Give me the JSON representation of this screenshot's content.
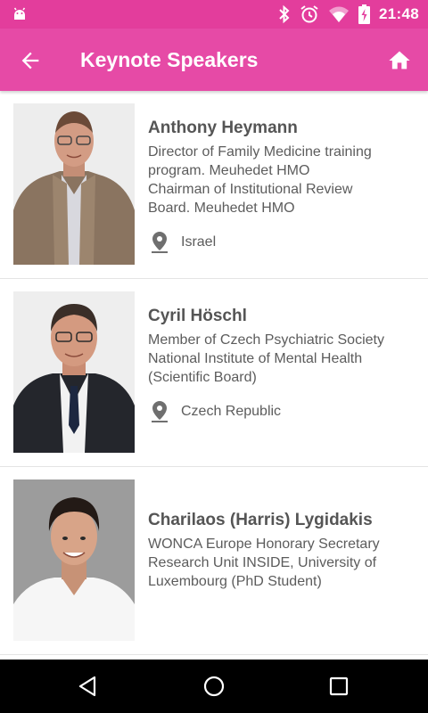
{
  "status_bar": {
    "time": "21:48",
    "icons": [
      "android-debug-icon",
      "bluetooth-icon",
      "alarm-icon",
      "wifi-icon",
      "battery-charging-icon"
    ]
  },
  "app_bar": {
    "title": "Keynote Speakers",
    "back_icon": "arrow-back-icon",
    "home_icon": "home-icon"
  },
  "speakers": [
    {
      "name": "Anthony Heymann",
      "description": [
        "Director of Family Medicine training",
        "program. Meuhedet HMO",
        "Chairman of Institutional Review",
        "Board. Meuhedet HMO"
      ],
      "location": "Israel"
    },
    {
      "name": "Cyril Höschl",
      "description": [
        "Member of Czech Psychiatric Society",
        "National Institute of Mental Health",
        "(Scientific Board)"
      ],
      "location": "Czech Republic"
    },
    {
      "name": "Charilaos (Harris) Lygidakis",
      "description": [
        "WONCA Europe Honorary Secretary",
        "Research Unit INSIDE, University of",
        "Luxembourg (PhD Student)"
      ],
      "location": ""
    }
  ],
  "nav_bar": {
    "icons": [
      "nav-back-icon",
      "nav-home-icon",
      "nav-recents-icon"
    ]
  },
  "colors": {
    "status_bar": "#e33d9c",
    "app_bar": "#e64aa6",
    "text": "#5c5c5c"
  }
}
